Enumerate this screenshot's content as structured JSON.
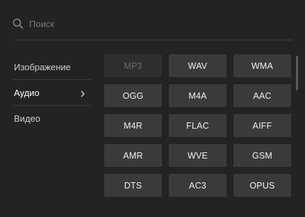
{
  "search": {
    "placeholder": "Поиск",
    "value": ""
  },
  "sidebar": {
    "items": [
      {
        "label": "Изображение",
        "active": false
      },
      {
        "label": "Аудио",
        "active": true
      },
      {
        "label": "Видео",
        "active": false
      }
    ]
  },
  "formats": [
    {
      "label": "MP3",
      "disabled": true
    },
    {
      "label": "WAV",
      "disabled": false
    },
    {
      "label": "WMA",
      "disabled": false
    },
    {
      "label": "OGG",
      "disabled": false
    },
    {
      "label": "M4A",
      "disabled": false
    },
    {
      "label": "AAC",
      "disabled": false
    },
    {
      "label": "M4R",
      "disabled": false
    },
    {
      "label": "FLAC",
      "disabled": false
    },
    {
      "label": "AIFF",
      "disabled": false
    },
    {
      "label": "AMR",
      "disabled": false
    },
    {
      "label": "WVE",
      "disabled": false
    },
    {
      "label": "GSM",
      "disabled": false
    },
    {
      "label": "DTS",
      "disabled": false
    },
    {
      "label": "AC3",
      "disabled": false
    },
    {
      "label": "OPUS",
      "disabled": false
    }
  ],
  "colors": {
    "background": "#232323",
    "button": "#3a3a3a",
    "button_disabled": "#2e2e2e",
    "text": "#f2f2f2"
  },
  "icons": {
    "search": "search-icon",
    "chevron": "chevron-right-icon"
  }
}
